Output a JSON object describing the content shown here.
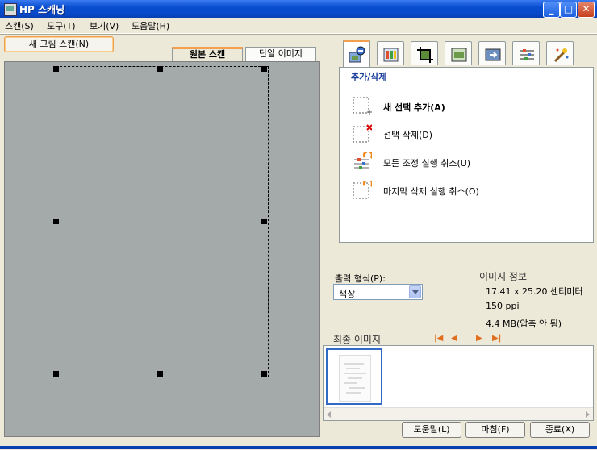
{
  "window": {
    "title": "HP 스캐닝"
  },
  "menu": [
    {
      "label": "스캔(S)"
    },
    {
      "label": "도구(T)"
    },
    {
      "label": "보기(V)"
    },
    {
      "label": "도움말(H)"
    }
  ],
  "toolbar": {
    "new_scan_label": "새 그림 스캔(N)"
  },
  "preview_tabs": [
    {
      "label": "원본 스캔",
      "active": true
    },
    {
      "label": "단일 이미지",
      "active": false
    }
  ],
  "right_tabs": [
    {
      "icon": "add-remove-selection-icon",
      "active": true
    },
    {
      "icon": "color-adjust-icon"
    },
    {
      "icon": "crop-icon"
    },
    {
      "icon": "resolution-icon"
    },
    {
      "icon": "output-icon"
    },
    {
      "icon": "adjust-sliders-icon"
    },
    {
      "icon": "auto-fix-icon"
    }
  ],
  "panel": {
    "title": "추가/삭제",
    "actions": [
      {
        "label": "새 선택 추가(A)",
        "icon": "add-selection-icon"
      },
      {
        "label": "선택 삭제(D)",
        "icon": "delete-selection-icon"
      },
      {
        "label": "모든 조정 실행 취소(U)",
        "icon": "undo-all-icon"
      },
      {
        "label": "마지막 삭제 실행 취소(O)",
        "icon": "undo-last-delete-icon"
      }
    ]
  },
  "output": {
    "label": "출력 형식(P):",
    "selected": "색상"
  },
  "image_info": {
    "title": "이미지 정보",
    "size": "17.41 x 25.20 센티미터",
    "resolution": "150 ppi",
    "file_size": "4.4 MB(압축 안 됨)"
  },
  "final": {
    "title": "최종 이미지"
  },
  "buttons": {
    "help": "도움말(L)",
    "finish": "마침(F)",
    "exit": "종료(X)"
  },
  "colors": {
    "accent": "#f0a050",
    "titlebar": "#0a4fd0",
    "panel_title": "#1a3e9c"
  }
}
